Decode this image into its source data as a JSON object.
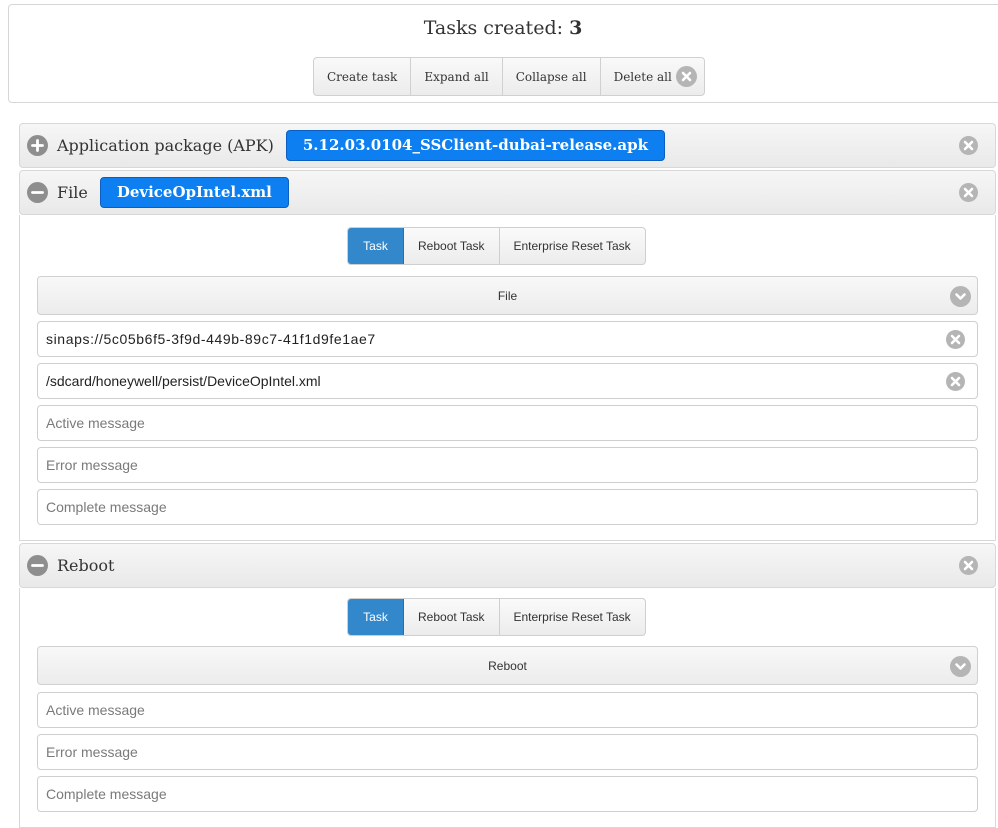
{
  "header": {
    "tasks_created_label": "Tasks created:",
    "tasks_created_count": "3",
    "buttons": {
      "create": "Create task",
      "expand": "Expand all",
      "collapse": "Collapse all",
      "delete": "Delete all"
    }
  },
  "tasks": [
    {
      "title": "Application package (APK)",
      "chip": "5.12.03.0104_SSClient-dubai-release.apk",
      "expanded": false
    },
    {
      "title": "File",
      "chip": "DeviceOpIntel.xml",
      "expanded": true,
      "tabs": [
        "Task",
        "Reboot Task",
        "Enterprise Reset Task"
      ],
      "active_tab": "Task",
      "selected_type": "File",
      "source_value": "sinaps://5c05b6f5-3f9d-449b-89c7-41f1d9fe1ae7",
      "destination_value": "/sdcard/honeywell/persist/DeviceOpIntel.xml",
      "placeholders": {
        "active": "Active message",
        "error": "Error message",
        "complete": "Complete message"
      }
    },
    {
      "title": "Reboot",
      "expanded": true,
      "tabs": [
        "Task",
        "Reboot Task",
        "Enterprise Reset Task"
      ],
      "active_tab": "Task",
      "selected_type": "Reboot",
      "placeholders": {
        "active": "Active message",
        "error": "Error message",
        "complete": "Complete message"
      }
    }
  ],
  "icons": {
    "expand": "plus-circle-icon",
    "collapse": "minus-circle-icon",
    "close": "close-circle-icon",
    "dropdown": "chevron-down-circle-icon",
    "clear": "clear-circle-icon"
  },
  "colors": {
    "chip": "#0d7ff0",
    "active_tab": "#3388cc",
    "icon_gray": "#b5b5b5"
  }
}
